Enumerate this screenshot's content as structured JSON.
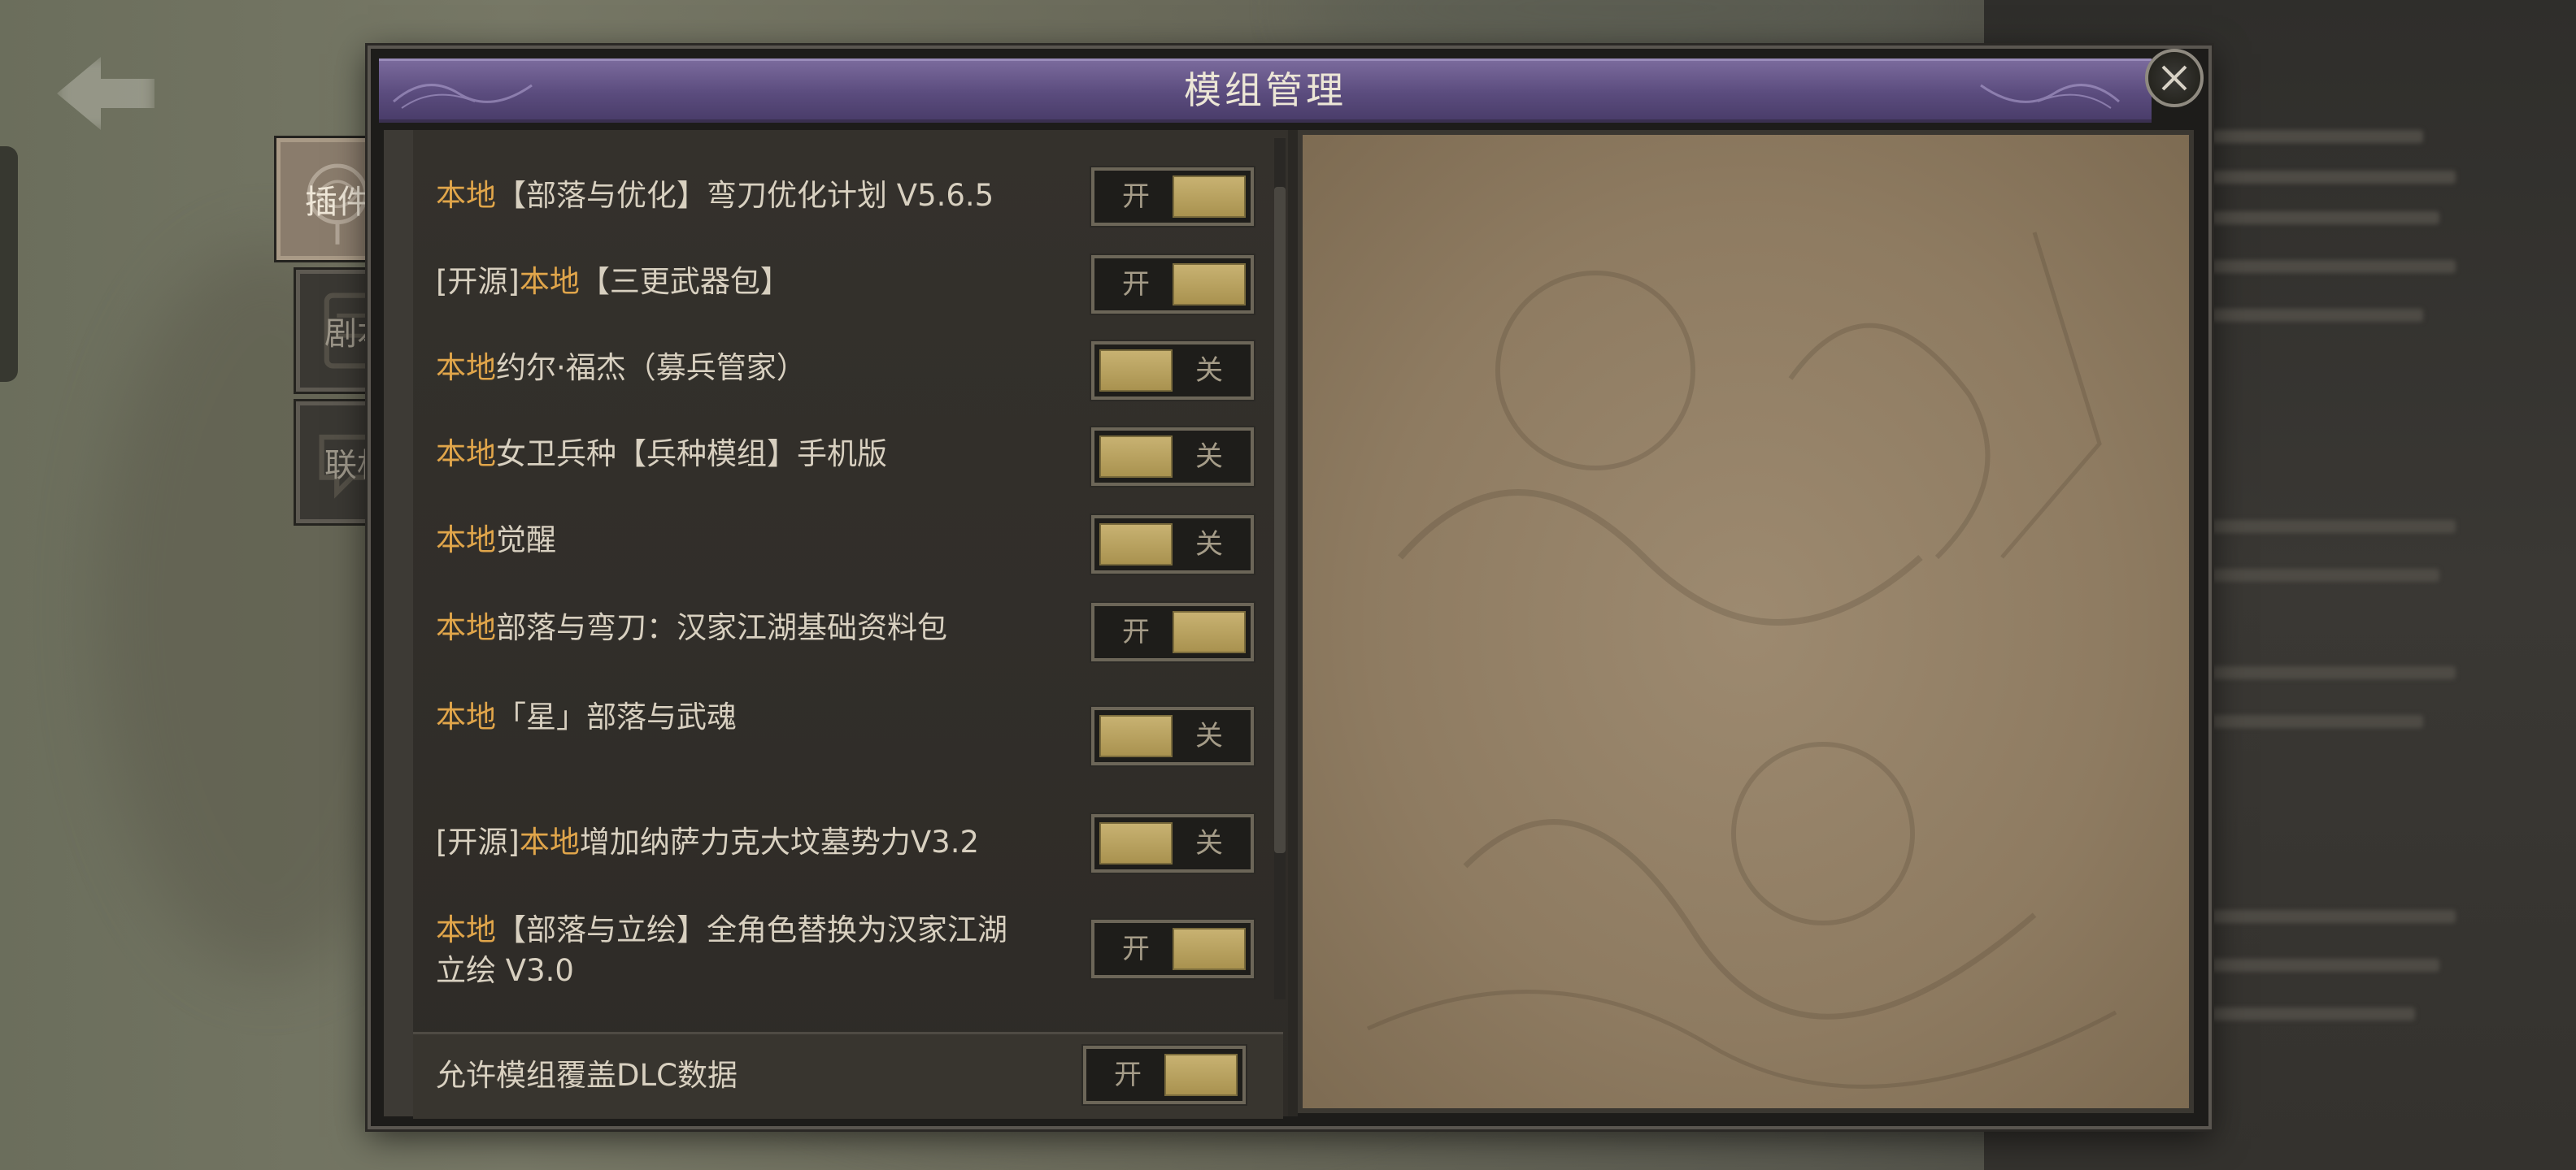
{
  "dialog": {
    "title": "模组管理"
  },
  "tabs": [
    {
      "label": "插件",
      "active": true
    },
    {
      "label": "剧本",
      "active": false
    },
    {
      "label": "联机",
      "active": false
    }
  ],
  "mods": [
    {
      "prefix": "",
      "local": "本地",
      "name": "【部落与优化】弯刀优化计划 V5.6.5",
      "name2": "",
      "toggle": "开",
      "state": "on"
    },
    {
      "prefix": "[开源]",
      "local": "本地",
      "name": "【三更武器包】",
      "name2": "",
      "toggle": "开",
      "state": "on"
    },
    {
      "prefix": "",
      "local": "本地",
      "name": "约尔·福杰（募兵管家）",
      "name2": "",
      "toggle": "关",
      "state": "off"
    },
    {
      "prefix": "",
      "local": "本地",
      "name": "女卫兵种【兵种模组】手机版",
      "name2": "",
      "toggle": "关",
      "state": "off"
    },
    {
      "prefix": "",
      "local": "本地",
      "name": "觉醒",
      "name2": "",
      "toggle": "关",
      "state": "off"
    },
    {
      "prefix": "",
      "local": "本地",
      "name": "部落与弯刀：汉家江湖基础资料包",
      "name2": "",
      "toggle": "开",
      "state": "on"
    },
    {
      "prefix": "",
      "local": "本地",
      "name": "「星」部落与武魂",
      "name2": "",
      "toggle": "关",
      "state": "off"
    },
    {
      "prefix": "[开源]",
      "local": "本地",
      "name": "增加纳萨力克大坟墓势力V3.2",
      "name2": "",
      "toggle": "关",
      "state": "off"
    },
    {
      "prefix": "",
      "local": "本地",
      "name": "【部落与立绘】全角色替换为汉家江湖",
      "name2": "立绘 V3.0",
      "toggle": "开",
      "state": "on"
    }
  ],
  "footer": {
    "label": "允许模组覆盖DLC数据",
    "toggle": "开",
    "state": "on"
  },
  "colors": {
    "title_bar": "#5b4c7e",
    "local_tag": "#e0a54a",
    "toggle_knob": "#c9b373",
    "preview_bg": "#9d8a70"
  },
  "icons": [
    "close-icon"
  ]
}
